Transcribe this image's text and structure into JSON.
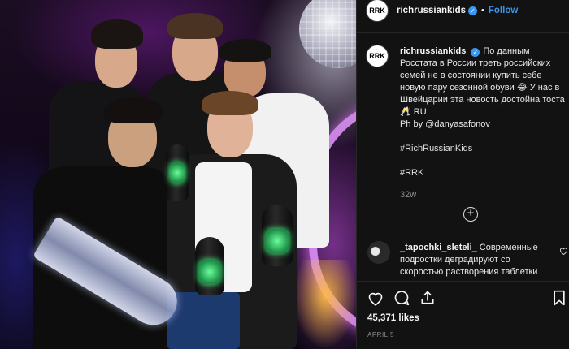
{
  "post": {
    "author": "richrussiankids",
    "avatar_text": "RRK",
    "follow_label": "Follow",
    "dot": "•",
    "verified_mark": "✓"
  },
  "caption": {
    "username": "richrussiankids",
    "text": "По данным Росстата в России треть российских семей не в состоянии купить себе новую пару сезонной обуви 😂  У нас в Швейцарии эта новость достойна тоста 🥂 RU",
    "credit": "Ph by @danyasafonov",
    "hashtag1": "#RichRussianKids",
    "hashtag2": "#RRK",
    "time_ago": "32w"
  },
  "load_more_icon": "plus-circle-icon",
  "comment": {
    "username": "_tapochki_sleteli_",
    "text": "Современные подростки деградируют со скоростью растворения таблетки"
  },
  "stats": {
    "likes": "45,371 likes",
    "date": "APRIL 5"
  },
  "icons": {
    "like": "heart-icon",
    "comment": "comment-icon",
    "share": "share-icon",
    "save": "bookmark-icon"
  },
  "colors": {
    "panel_bg": "#121212",
    "follow": "#3897f0",
    "muted": "#8e8e8e"
  }
}
